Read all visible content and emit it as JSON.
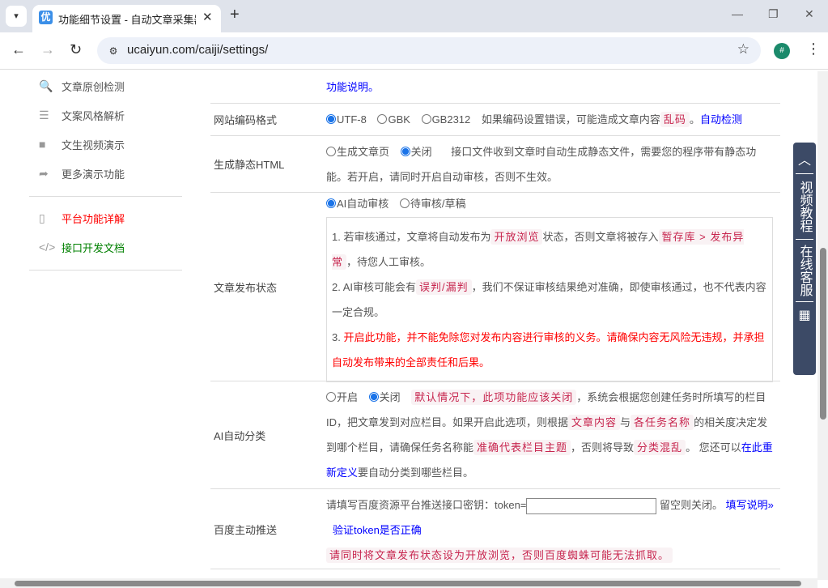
{
  "browser": {
    "tab_title": "功能细节设置 - 自动文章采集器",
    "favicon": "优",
    "url": "ucaiyun.com/caiji/settings/",
    "profile": "#"
  },
  "sidebar": {
    "items": [
      {
        "icon": "search-icon",
        "glyph": "🔍",
        "label": "文章原创检测",
        "color": "#555"
      },
      {
        "icon": "list-ordered-icon",
        "glyph": "☰",
        "label": "文案风格解析",
        "color": "#555"
      },
      {
        "icon": "video-camera-icon",
        "glyph": "■",
        "label": "文生视频演示",
        "color": "#555"
      },
      {
        "icon": "share-arrow-icon",
        "glyph": "➦",
        "label": "更多演示功能",
        "color": "#555"
      }
    ],
    "items2": [
      {
        "icon": "document-icon",
        "glyph": "▯",
        "label": "平台功能详解",
        "color": "#ff0000"
      },
      {
        "icon": "code-icon",
        "glyph": "</>",
        "label": "接口开发文档",
        "color": "#008000"
      }
    ]
  },
  "rows": {
    "r0": {
      "link": "功能说明。"
    },
    "r1": {
      "label": "网站编码格式",
      "opts": [
        "UTF-8",
        "GBK",
        "GB2312"
      ],
      "selected": "UTF-8",
      "t1": "如果编码设置错误，可能造成文章内容",
      "c1": "乱码",
      "t2": "。",
      "link": "自动检测"
    },
    "r2": {
      "label": "生成静态HTML",
      "opts": [
        "生成文章页",
        "关闭"
      ],
      "selected": "关闭",
      "t1": "接口文件收到文章时自动生成静态文件，需要您的程序带有静态功能。若开启，请同时开启自动审核，否则不生效。"
    },
    "r3": {
      "label": "文章发布状态",
      "opts": [
        "AI自动审核",
        "待审核/草稿"
      ],
      "selected": "AI自动审核",
      "p1a": "1. 若审核通过，文章将自动发布为",
      "p1c1": "开放浏览",
      "p1b": "状态，否则文章将被存入",
      "p1c2": "暂存库 > 发布异常",
      "p1d": "，待您人工审核。",
      "p2a": "2. AI审核可能会有",
      "p2c": "误判/漏判",
      "p2b": "，我们不保证审核结果绝对准确，即使审核通过，也不代表内容一定合规。",
      "p3a": "3. ",
      "p3b": "开启此功能，并不能免除您对发布内容进行审核的义务。请确保内容无风险无违规，并承担自动发布带来的全部责任和后果。"
    },
    "r4": {
      "label": "AI自动分类",
      "opts": [
        "开启",
        "关闭"
      ],
      "selected": "关闭",
      "c1": "默认情况下，此项功能应该关闭",
      "t1": "，系统会根据您创建任务时所填写的栏目ID，把文章发到对应栏目。如果开启此选项，则根据",
      "c2": "文章内容",
      "t2": "与",
      "c3": "各任务名称",
      "t3": "的相关度决定发到哪个栏目，请确保任务名称能",
      "c4": "准确代表栏目主题",
      "t4": "，否则将导致",
      "c5": "分类混乱",
      "t5": "。 您还可以",
      "link": "在此重新定义",
      "t6": "要自动分类到哪些栏目。"
    },
    "r5": {
      "label": "百度主动推送",
      "t1": "请填写百度资源平台推送接口密钥：token=",
      "token_value": "",
      "t2": "留空则关闭。",
      "link1": "填写说明»",
      "link2": "验证token是否正确",
      "c1": "请同时将文章发布状态设为开放浏览，否则百度蜘蛛可能无法抓取。"
    }
  },
  "float": {
    "top": "︿",
    "video": "视频教程",
    "service": "在线客服",
    "qr": "▦"
  },
  "colors": {
    "link": "#0000ff",
    "code": "#c7254e",
    "warn": "#ff0000",
    "float_bg": "#3c4a66"
  }
}
